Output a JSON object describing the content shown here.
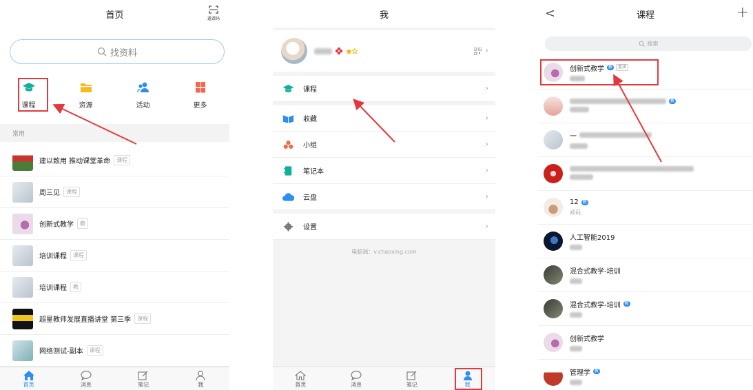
{
  "colors": {
    "accent": "#2d8df0",
    "annotation": "#e4393c",
    "course_green": "#0fb198",
    "resource_yellow": "#fcb919",
    "more_red": "#f26750"
  },
  "home": {
    "title": "首页",
    "invite_label": "邀请码",
    "search_placeholder": "找资料",
    "quick": [
      {
        "label": "课程",
        "icon": "graduation-cap-icon"
      },
      {
        "label": "资源",
        "icon": "folder-icon"
      },
      {
        "label": "活动",
        "icon": "people-icon"
      },
      {
        "label": "更多",
        "icon": "grid-icon"
      }
    ],
    "section_label": "常用",
    "items": [
      {
        "title": "建以致用 推动课堂革命",
        "tag": "课程"
      },
      {
        "title": "周三见",
        "tag": "课程"
      },
      {
        "title": "创新式教学",
        "tag": "教"
      },
      {
        "title": "培训课程",
        "tag": "课程"
      },
      {
        "title": "培训课程",
        "tag": "教"
      },
      {
        "title": "超星教师发展直播讲堂 第三季",
        "tag": "课程"
      },
      {
        "title": "网络测试-副本",
        "tag": "课程"
      }
    ]
  },
  "tabs": [
    "首页",
    "消息",
    "笔记",
    "我"
  ],
  "me": {
    "title": "我",
    "menu": [
      {
        "label": "课程",
        "icon": "graduation-cap-icon"
      },
      {
        "label": "收藏",
        "icon": "bookmark-icon"
      },
      {
        "label": "小组",
        "icon": "group-icon"
      },
      {
        "label": "笔记本",
        "icon": "notebook-icon"
      },
      {
        "label": "云盘",
        "icon": "cloud-icon"
      },
      {
        "label": "设置",
        "icon": "gear-icon"
      }
    ],
    "footer": "电脑端：v.chaoxing.com"
  },
  "courses": {
    "title": "课程",
    "back": "<",
    "add": "+",
    "search_placeholder": "搜索",
    "badge_teach": "教",
    "badge_repeat": "重演",
    "items": [
      {
        "title": "创新式教学",
        "sub": ""
      },
      {
        "title": "",
        "sub": ""
      },
      {
        "title": "一",
        "sub": ""
      },
      {
        "title": "",
        "sub": ""
      },
      {
        "title": "12",
        "sub": "郑莉"
      },
      {
        "title": "人工智能2019",
        "sub": ""
      },
      {
        "title": "混合式教学-培训",
        "sub": ""
      },
      {
        "title": "混合式教学-培训",
        "sub": ""
      },
      {
        "title": "创新式教学",
        "sub": ""
      },
      {
        "title": "管理学",
        "sub": ""
      }
    ]
  }
}
